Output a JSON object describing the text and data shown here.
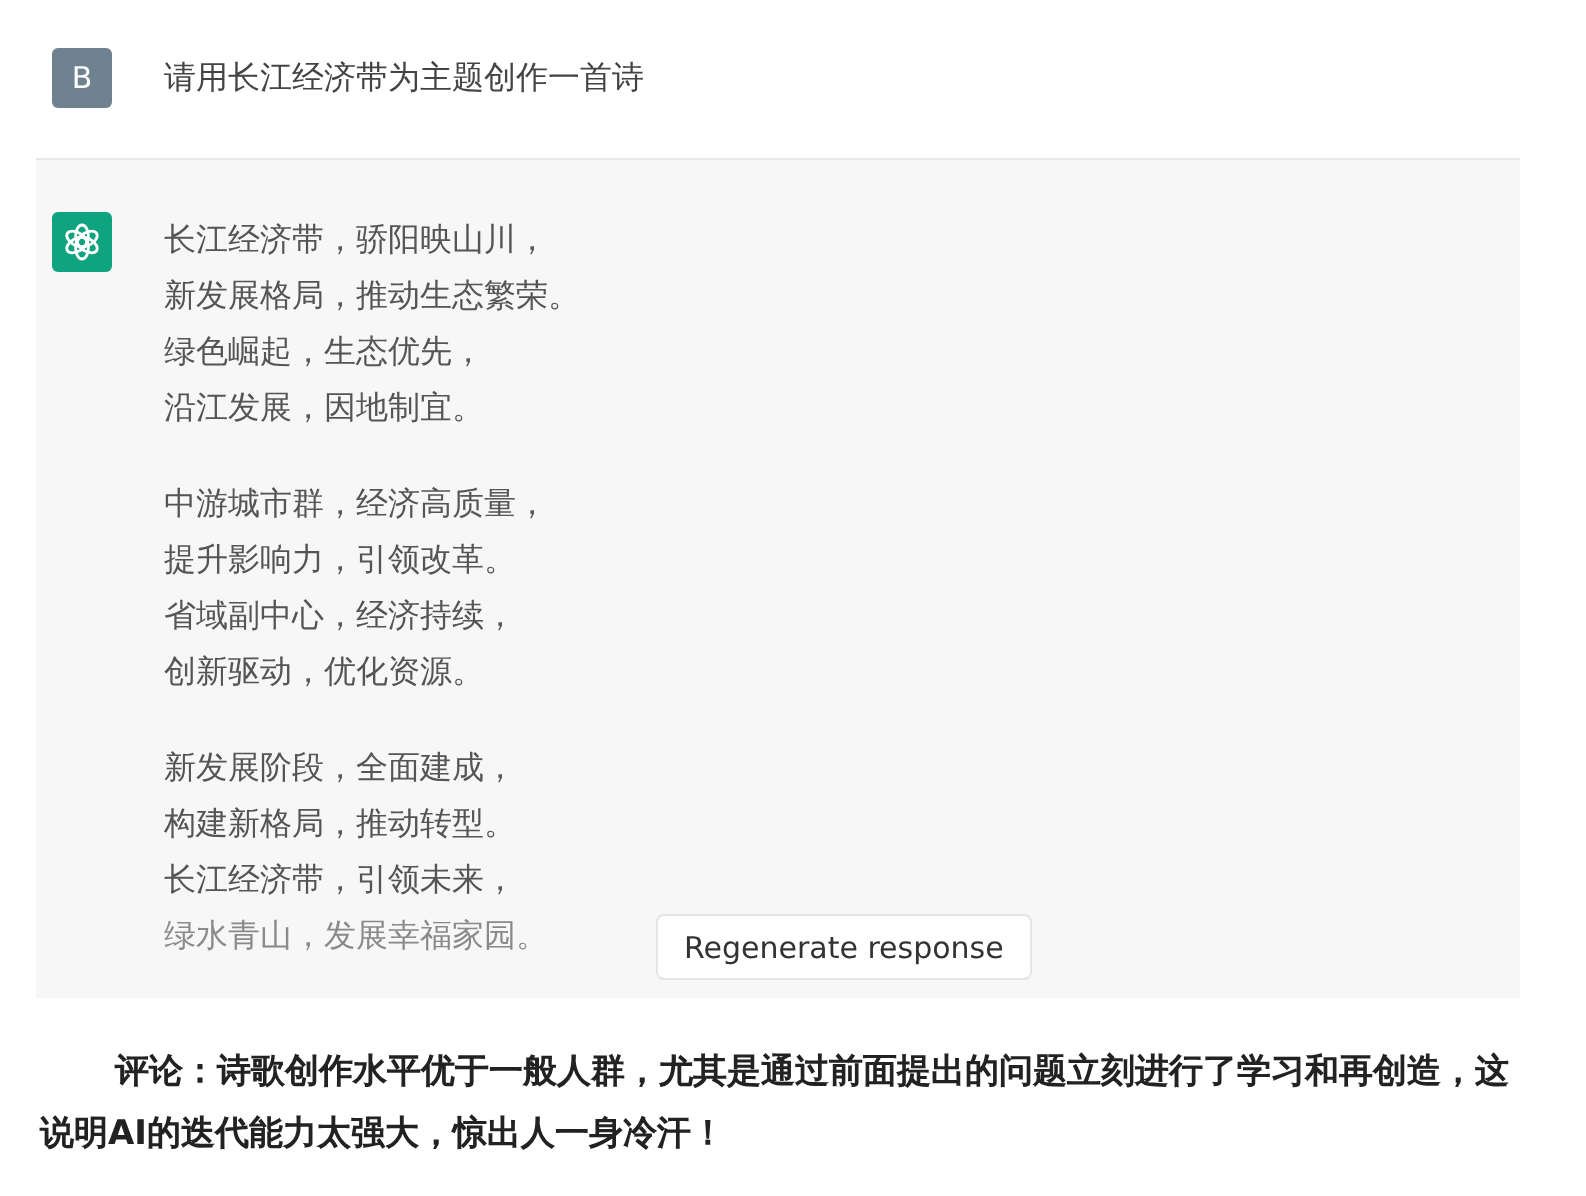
{
  "user_message": {
    "avatar": "B",
    "text": "请用长江经济带为主题创作一首诗"
  },
  "response": {
    "stanzas": [
      [
        "长江经济带，骄阳映山川，",
        "新发展格局，推动生态繁荣。",
        "绿色崛起，生态优先，",
        "沿江发展，因地制宜。"
      ],
      [
        "中游城市群，经济高质量，",
        "提升影响力，引领改革。",
        "省域副中心，经济持续，",
        "创新驱动，优化资源。"
      ],
      [
        "新发展阶段，全面建成，",
        "构建新格局，推动转型。",
        "长江经济带，引领未来，",
        "绿水青山，发展幸福家园。"
      ]
    ]
  },
  "regenerate_button": {
    "label": "Regenerate response"
  },
  "comment": "评论：诗歌创作水平优于一般人群，尤其是通过前面提出的问题立刻进行了学习和再创造，这说明AI的迭代能力太强大，惊出人一身冷汗！"
}
